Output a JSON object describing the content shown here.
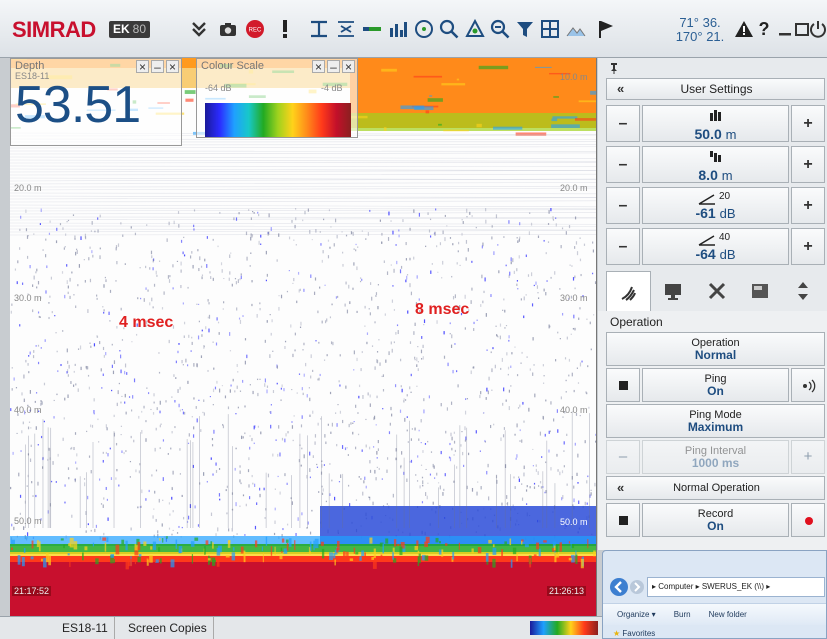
{
  "toolbar": {
    "brand": "SIMRAD",
    "model": "EK",
    "model_sub": "80",
    "coord_lat": "71° 36.",
    "coord_lon": "170° 21.",
    "help_label": "?",
    "icons": [
      "chevrons-down-icon",
      "camera-icon",
      "record-icon",
      "alert-icon",
      "range-icon",
      "zoom-icon",
      "bar-icon",
      "chart-icon",
      "target-icon",
      "search-icon",
      "shape-icon",
      "search-minus-icon",
      "filter-icon",
      "grid-icon",
      "terrain-icon",
      "flag-icon"
    ]
  },
  "depth_panel": {
    "title": "Depth",
    "channel": "ES18-11",
    "value": "53.51"
  },
  "colour_panel": {
    "title": "Colour Scale",
    "min_label": "-64 dB",
    "max_label": "-4 dB"
  },
  "echogram": {
    "depth_labels_left": [
      "20.0 m",
      "30.0 m",
      "40.0 m",
      "50.0 m"
    ],
    "depth_labels_right": [
      "10.0 m",
      "20.0 m",
      "30.0 m",
      "40.0 m",
      "50.0 m"
    ],
    "time_start": "21:17:52",
    "time_end": "21:26:13",
    "annot_left": "4 msec",
    "annot_right": "8 msec"
  },
  "right_panel": {
    "user_settings_label": "User Settings",
    "collapse_label": "«",
    "steppers": [
      {
        "value": "50.0",
        "unit": "m",
        "icon": "range-bars-icon"
      },
      {
        "value": "8.0",
        "unit": "m",
        "icon": "start-bars-icon"
      },
      {
        "value": "-61",
        "unit": "dB",
        "sup": "20",
        "icon": "tvg-angle-icon"
      },
      {
        "value": "-64",
        "unit": "dB",
        "sup": "40",
        "icon": "tvg-angle-icon"
      }
    ],
    "minus_label": "–",
    "plus_label": "+",
    "section_title": "Operation",
    "operation": {
      "name": "Operation",
      "value": "Normal"
    },
    "ping": {
      "name": "Ping",
      "value": "On"
    },
    "ping_mode": {
      "name": "Ping Mode",
      "value": "Maximum"
    },
    "ping_interval": {
      "name": "Ping Interval",
      "value": "1000 ms"
    },
    "normal_operation_label": "Normal Operation",
    "record": {
      "name": "Record",
      "value": "On"
    }
  },
  "explorer": {
    "address": "▸ Computer ▸ SWERUS_EK (\\\\) ▸",
    "organize": "Organize ▾",
    "burn": "Burn",
    "new_folder": "New folder",
    "favorites": "Favorites"
  },
  "taskbar": {
    "tab1": "ES18-11",
    "tab2": "Screen Copies"
  }
}
